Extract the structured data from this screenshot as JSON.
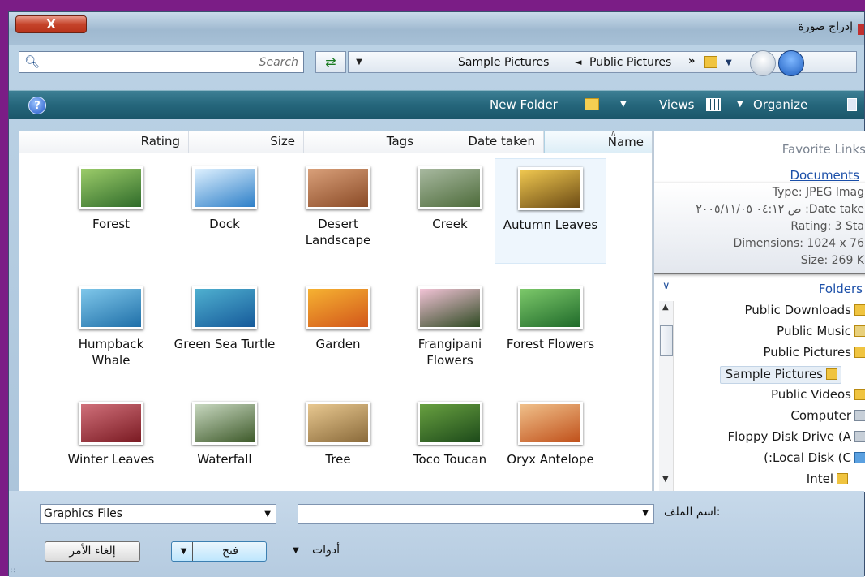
{
  "window": {
    "title": "إدراج صورة",
    "close_label": "X"
  },
  "address": {
    "search_placeholder": "Search",
    "crumb1": "Sample Pictures",
    "crumb2": "Public Pictures",
    "sep1": "◄",
    "sep2": "»"
  },
  "toolbar": {
    "new_folder": "New Folder",
    "views": "Views",
    "organize": "Organize"
  },
  "columns": [
    "Rating",
    "Size",
    "Tags",
    "Date taken",
    "Name"
  ],
  "items": [
    {
      "name": "Forest",
      "color1": "#2f6b2a",
      "color2": "#9ccc6a"
    },
    {
      "name": "Dock",
      "color1": "#2d7fc8",
      "color2": "#dff1ff"
    },
    {
      "name": "Desert Landscape",
      "color1": "#8a4a26",
      "color2": "#d9a07a"
    },
    {
      "name": "Creek",
      "color1": "#4d6b3a",
      "color2": "#a8b9a0"
    },
    {
      "name": "Autumn Leaves",
      "color1": "#6b4a14",
      "color2": "#f0c850"
    },
    {
      "name": "Humpback Whale",
      "color1": "#1f6fa8",
      "color2": "#7fc7ea"
    },
    {
      "name": "Green Sea Turtle",
      "color1": "#165a9a",
      "color2": "#4fb0d0"
    },
    {
      "name": "Garden",
      "color1": "#d2561a",
      "color2": "#f6b232"
    },
    {
      "name": "Frangipani Flowers",
      "color1": "#2e4a22",
      "color2": "#f2c3d6"
    },
    {
      "name": "Forest Flowers",
      "color1": "#1f6a2a",
      "color2": "#7cc86a"
    },
    {
      "name": "Winter Leaves",
      "color1": "#7a1a22",
      "color2": "#d0707a"
    },
    {
      "name": "Waterfall",
      "color1": "#3e5a2a",
      "color2": "#c8d8c0"
    },
    {
      "name": "Tree",
      "color1": "#8a6a3a",
      "color2": "#e8c890"
    },
    {
      "name": "Toco Toucan",
      "color1": "#1d4a1a",
      "color2": "#68a040"
    },
    {
      "name": "Oryx Antelope",
      "color1": "#c0501a",
      "color2": "#f0c08a"
    }
  ],
  "selected_item": "Autumn Leaves",
  "right_pane": {
    "favorite_links": "Favorite Links",
    "documents": "Documents",
    "tooltip": {
      "type": "Type: JPEG Imag",
      "date": "ص ٠٤:١٢ ٢٠٠٥/١١/٠٥ :Date take",
      "rating": "Rating: 3 Sta",
      "dimensions": "Dimensions: 1024 x 76",
      "size": "Size: 269 K"
    },
    "folders": "Folders",
    "tree": [
      "Public Downloads",
      "Public Music",
      "Public Pictures",
      "Sample Pictures",
      "Public Videos",
      "Computer",
      "Floppy Disk Drive (A",
      "(:Local Disk (C",
      "Intel"
    ]
  },
  "bottom": {
    "file_type": "Graphics Files",
    "file_name_value": "",
    "file_name_label": "اسم الملف:",
    "tools": "أدوات",
    "open": "فتح",
    "cancel": "إلغاء الأمر"
  }
}
